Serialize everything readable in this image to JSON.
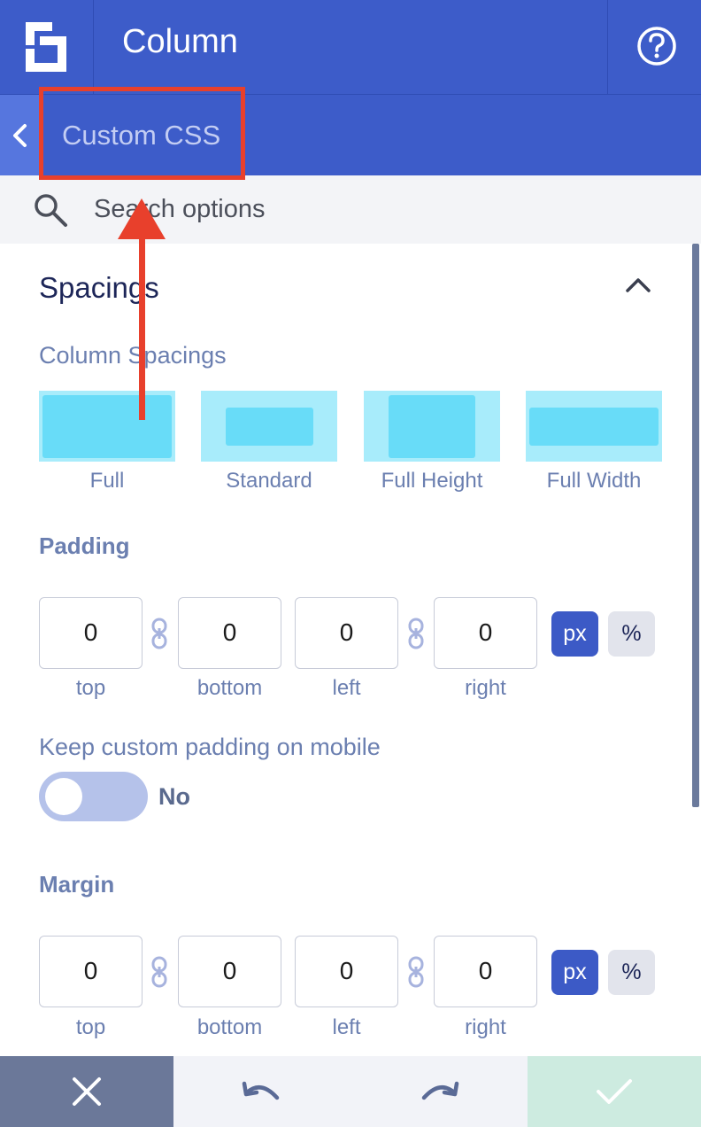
{
  "header": {
    "title": "Column"
  },
  "breadcrumb": {
    "label": "Custom CSS"
  },
  "search": {
    "placeholder": "Search options"
  },
  "section": {
    "title": "Spacings"
  },
  "column_spacings": {
    "label": "Column Spacings",
    "presets": [
      "Full",
      "Standard",
      "Full Height",
      "Full Width"
    ]
  },
  "padding": {
    "label": "Padding",
    "values": {
      "top": "0",
      "bottom": "0",
      "left": "0",
      "right": "0"
    },
    "labels": {
      "top": "top",
      "bottom": "bottom",
      "left": "left",
      "right": "right"
    },
    "units": {
      "px": "px",
      "percent": "%"
    },
    "active_unit": "px"
  },
  "mobile_padding": {
    "label": "Keep custom padding on mobile",
    "state": "No"
  },
  "margin": {
    "label": "Margin",
    "values": {
      "top": "0",
      "bottom": "0",
      "left": "0",
      "right": "0"
    },
    "labels": {
      "top": "top",
      "bottom": "bottom",
      "left": "left",
      "right": "right"
    },
    "units": {
      "px": "px",
      "percent": "%"
    },
    "active_unit": "px"
  },
  "colors": {
    "header_bg": "#3d5cc9",
    "accent": "#3c5ac6",
    "preset_light": "#a8ecfb",
    "preset_dark": "#68dcf8",
    "annotation_red": "#e8402c",
    "confirm_bg": "#cdebe0",
    "cancel_bg": "#6b7899"
  },
  "footer": {
    "icons": [
      "close-icon",
      "undo-icon",
      "redo-icon",
      "check-icon"
    ]
  }
}
